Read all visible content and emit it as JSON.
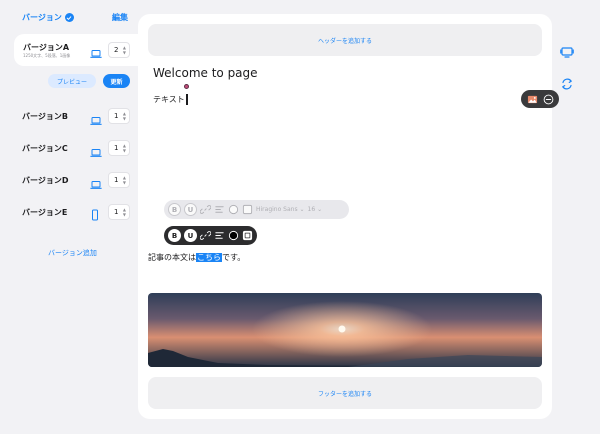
{
  "sidebar": {
    "title": "バージョン",
    "edit_label": "編集",
    "active": {
      "name": "バージョンA",
      "sub": "1250文字、5段落、1画像",
      "count": "2",
      "device": "laptop-icon"
    },
    "preview_label": "プレビュー",
    "update_label": "更新",
    "versions": [
      {
        "name": "バージョンB",
        "count": "1",
        "device": "laptop-icon"
      },
      {
        "name": "バージョンC",
        "count": "1",
        "device": "laptop-icon"
      },
      {
        "name": "バージョンD",
        "count": "1",
        "device": "laptop-icon"
      },
      {
        "name": "バージョンE",
        "count": "1",
        "device": "phone-icon"
      }
    ],
    "add_label": "バージョン追加"
  },
  "editor": {
    "header_placeholder": "ヘッダーを追加する",
    "title": "Welcome to page",
    "text_block": "テキスト",
    "toolbar_ghost": {
      "bold": "B",
      "underline": "U",
      "font": "Hiragino Sans",
      "size": "16"
    },
    "toolbar_active": {
      "bold": "B",
      "underline": "U"
    },
    "body_prefix": "記事の本文は",
    "body_selected": "こちら",
    "body_suffix": "です。",
    "footer_placeholder": "フッターを追加する"
  },
  "colors": {
    "accent": "#1a84f5",
    "toolbar_dark": "#2c2c2e",
    "panel": "#efeff1"
  }
}
